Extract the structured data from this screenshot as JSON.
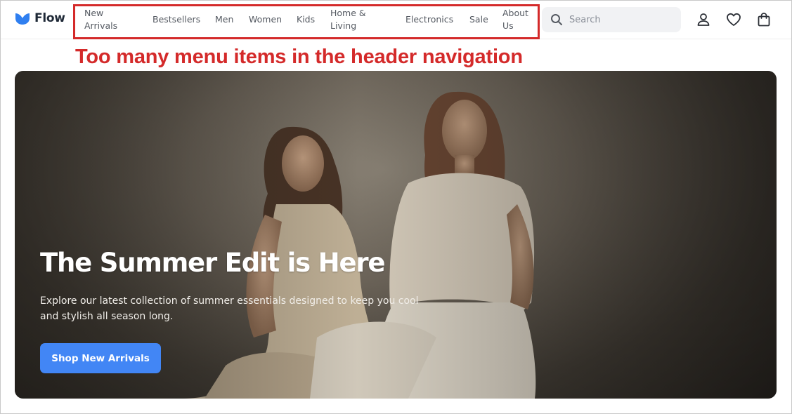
{
  "brand": {
    "name": "Flow",
    "color": "#2f7ff0"
  },
  "nav": {
    "items": [
      {
        "line1": "New",
        "line2": "Arrivals"
      },
      {
        "line1": "Bestsellers"
      },
      {
        "line1": "Men"
      },
      {
        "line1": "Women"
      },
      {
        "line1": "Kids"
      },
      {
        "line1": "Home &",
        "line2": "Living"
      },
      {
        "line1": "Electronics"
      },
      {
        "line1": "Sale"
      },
      {
        "line1": "About",
        "line2": "Us"
      }
    ]
  },
  "search": {
    "placeholder": "Search",
    "icon": "search-icon"
  },
  "header_icons": [
    "user-icon",
    "heart-icon",
    "shopping-bag-icon"
  ],
  "annotation": {
    "text": "Too many menu items in the header navigation",
    "color": "#d42a2a"
  },
  "hero": {
    "title": "The Summer Edit is Here",
    "subtitle": "Explore our latest collection of summer essentials designed to keep you cool and stylish all season long.",
    "cta_label": "Shop New Arrivals",
    "cta_color": "#4286f5"
  }
}
